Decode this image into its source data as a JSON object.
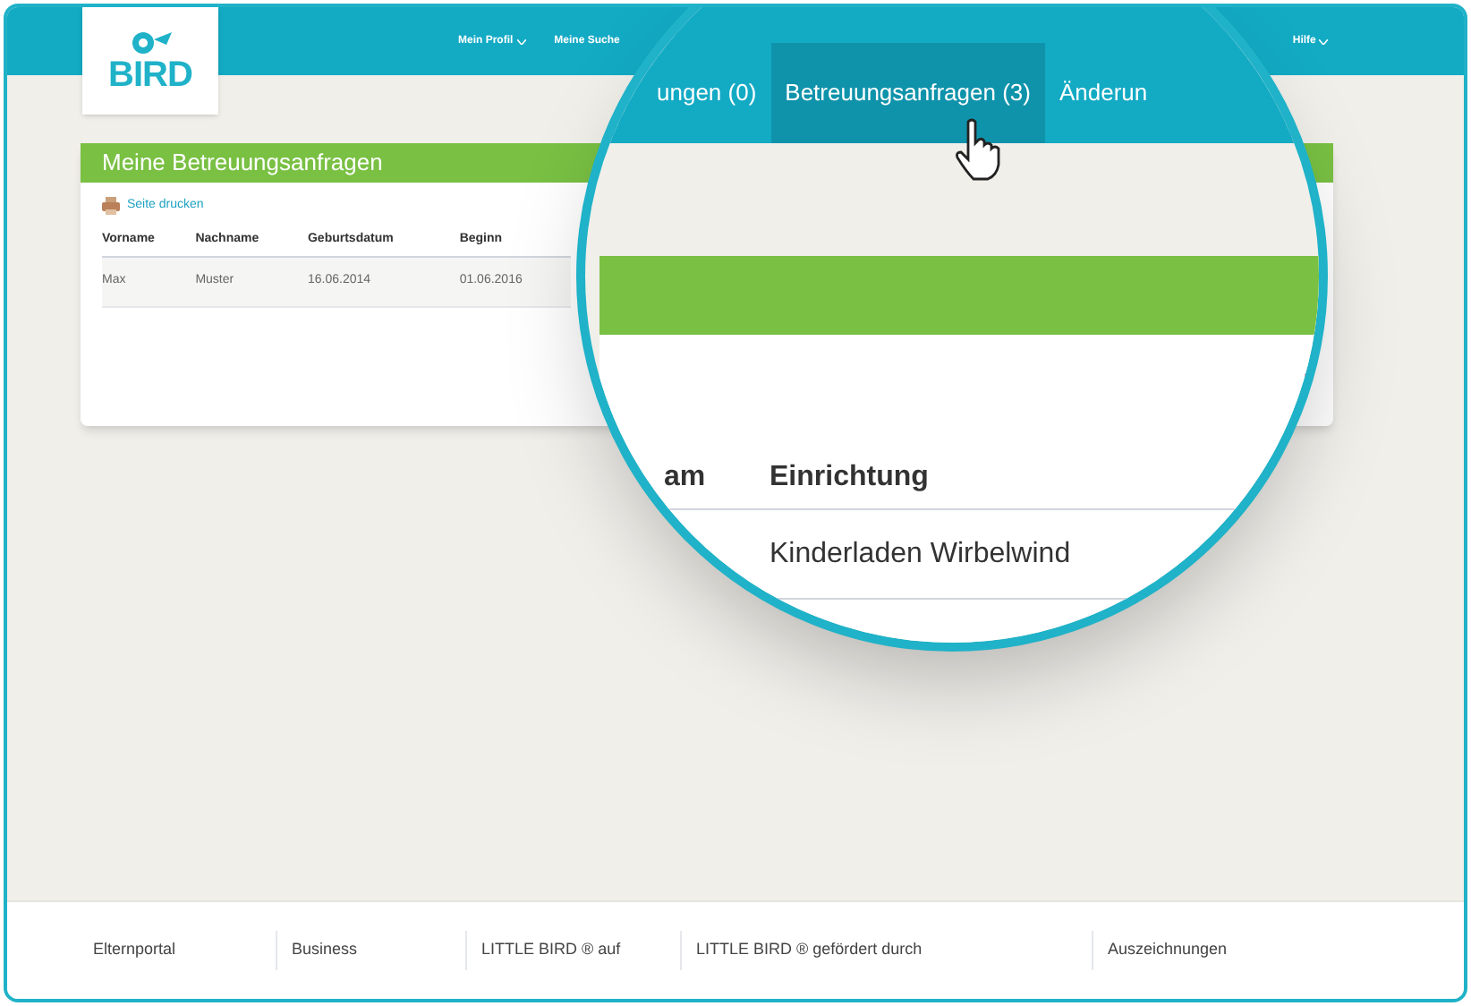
{
  "header": {
    "logo_text": "BIRD",
    "nav": [
      {
        "label": "Mein Profil",
        "dropdown": true
      },
      {
        "label": "Meine Suche",
        "dropdown": false
      },
      {
        "label": "Hilfe",
        "dropdown": true
      }
    ]
  },
  "card": {
    "title": "Meine Betreuungsanfragen",
    "print_link": "Seite drucken",
    "columns": [
      "Vorname",
      "Nachname",
      "Geburtsdatum",
      "Beginn"
    ],
    "rows": [
      [
        "Max",
        "Muster",
        "16.06.2014",
        "01.06.2016"
      ]
    ]
  },
  "magnifier": {
    "tabs": [
      {
        "label": "ungen (0)",
        "selected": false
      },
      {
        "label": "Betreuungsanfragen (3)",
        "selected": true
      },
      {
        "label": "Änderun",
        "selected": false
      }
    ],
    "columns": [
      "am",
      "Einrichtung"
    ],
    "rows": [
      [
        "",
        "Kinderladen Wirbelwind"
      ]
    ]
  },
  "footer": [
    "Elternportal",
    "Business",
    "LITTLE BIRD ® auf",
    "LITTLE BIRD ® gefördert durch",
    "Auszeichnungen"
  ]
}
